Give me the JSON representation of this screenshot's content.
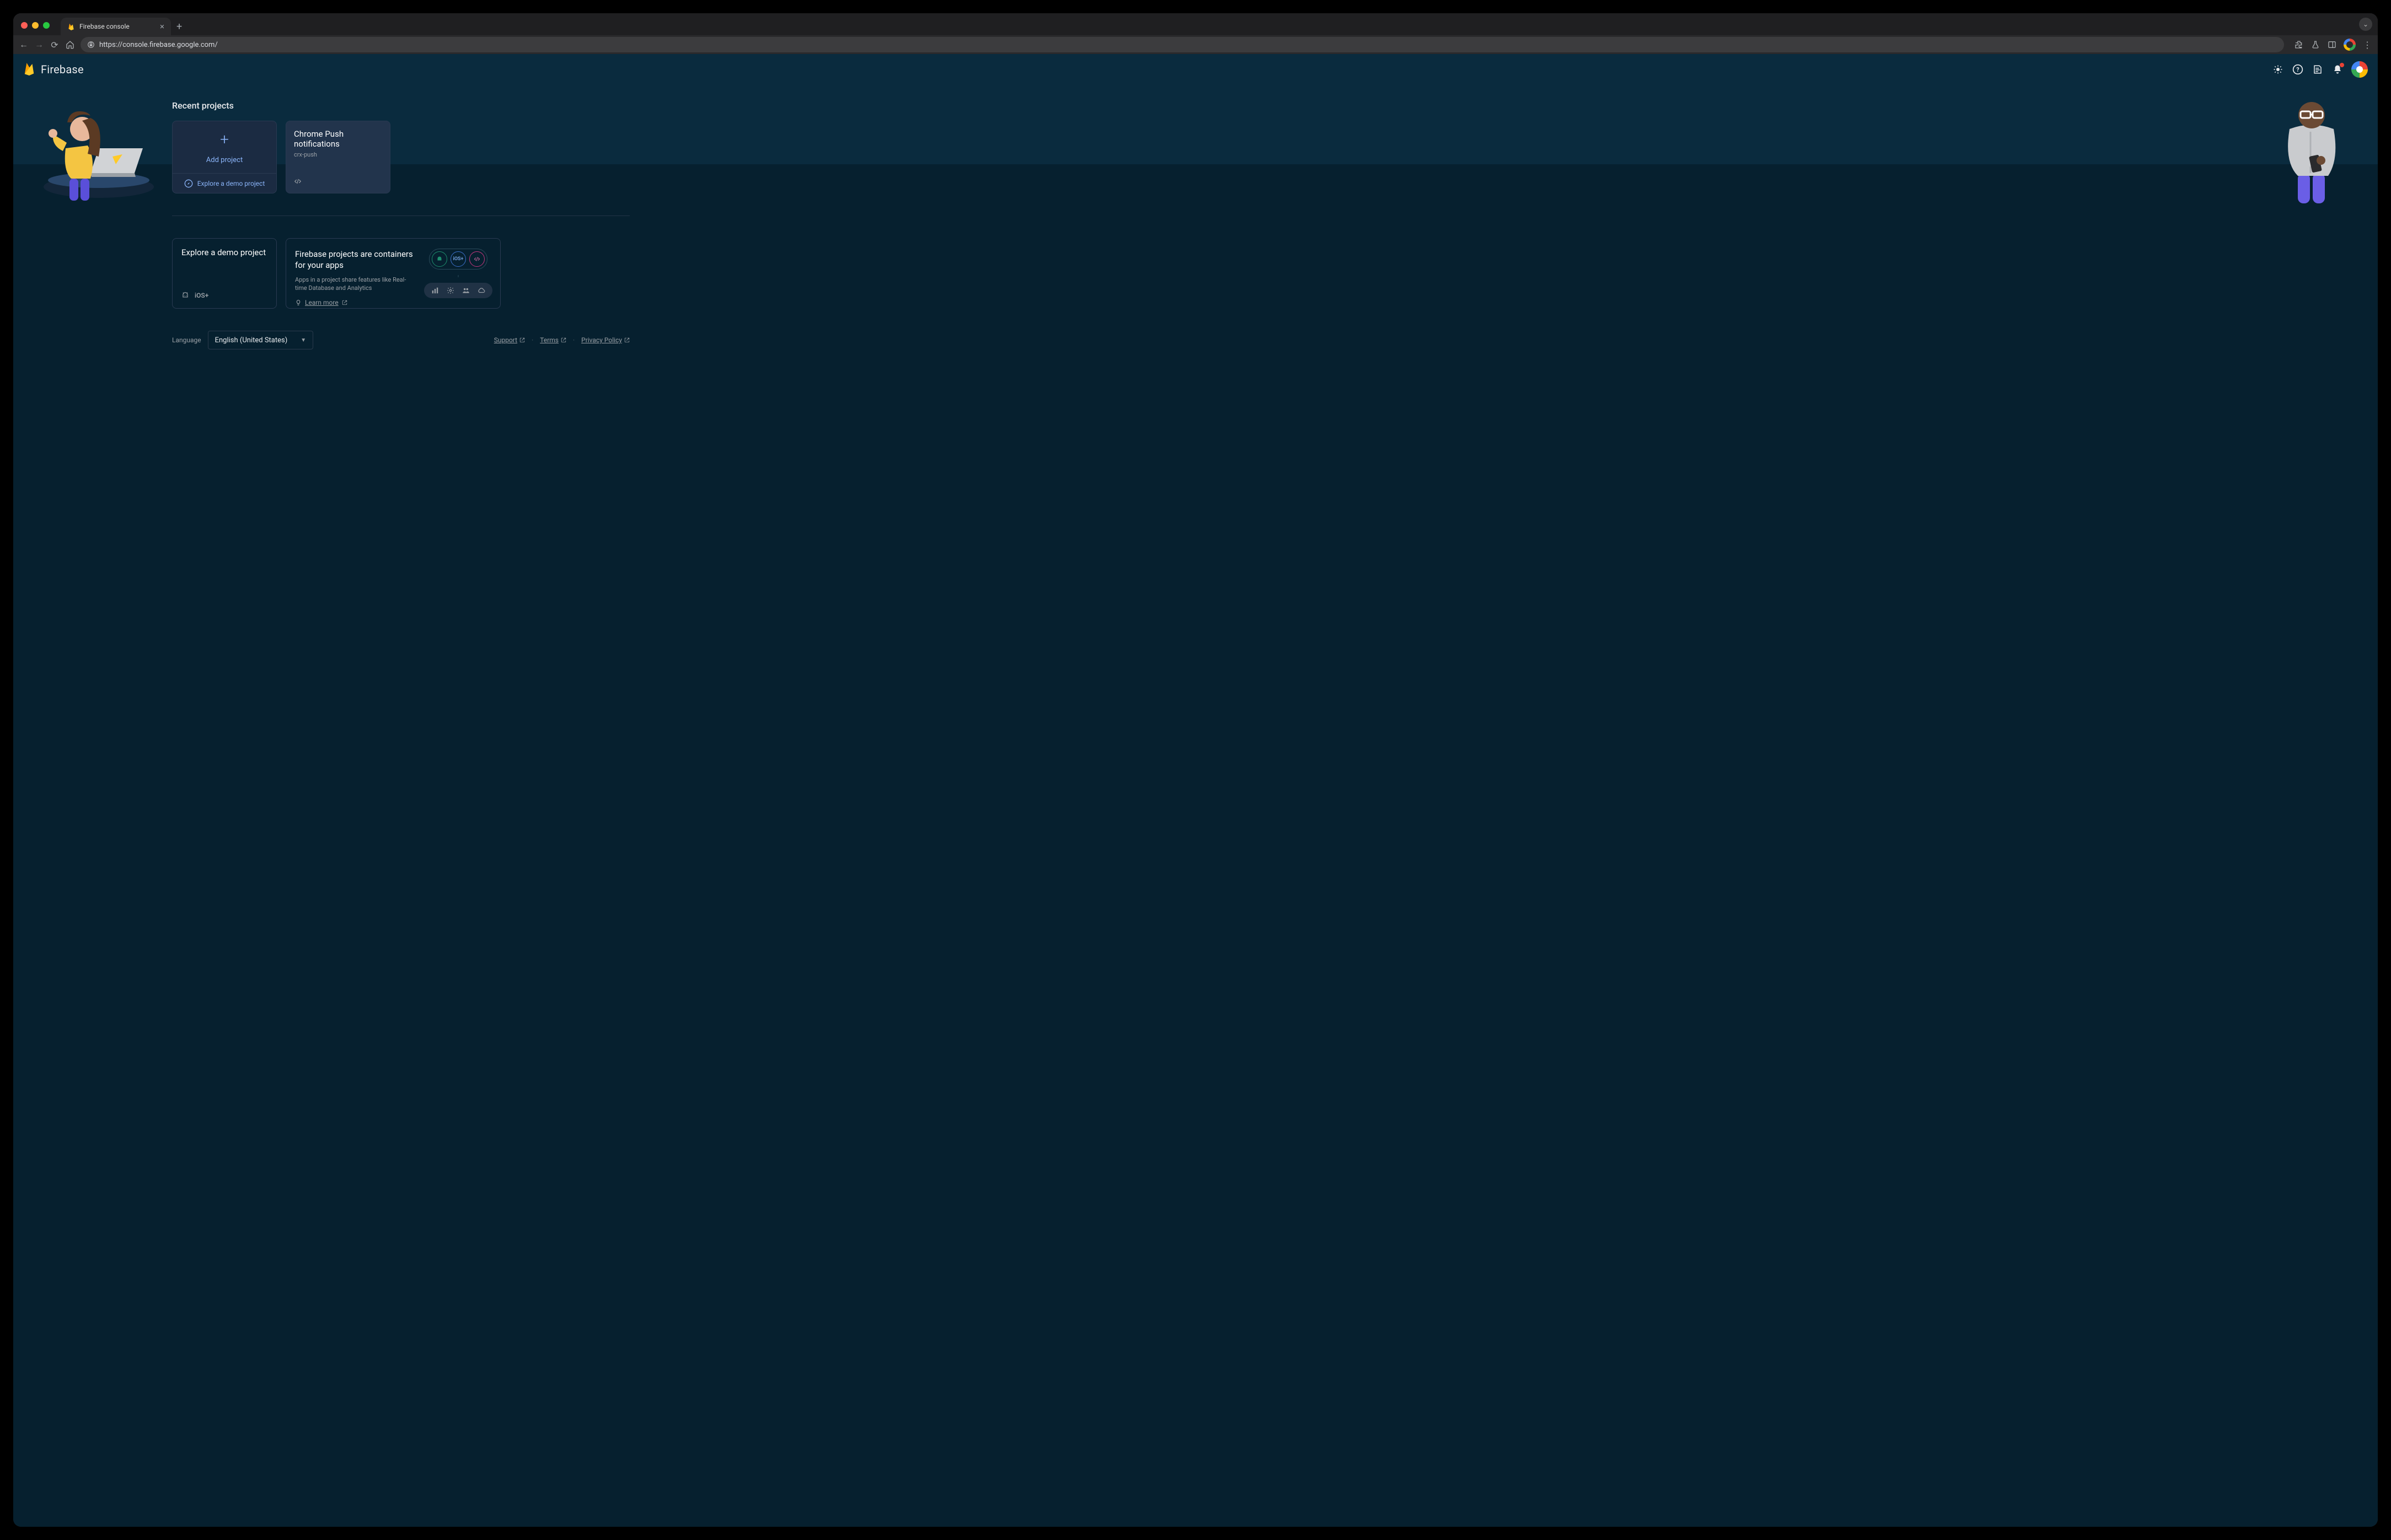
{
  "browser": {
    "tab_title": "Firebase console",
    "url": "https://console.firebase.google.com/"
  },
  "header": {
    "brand": "Firebase"
  },
  "recent": {
    "title": "Recent projects",
    "add_label": "Add project",
    "explore_label": "Explore a demo project",
    "projects": [
      {
        "name": "Chrome Push notifications",
        "id": "crx-push"
      }
    ]
  },
  "explore_card": {
    "title": "Explore a demo project",
    "ios_label": "iOS+"
  },
  "container_card": {
    "title": "Firebase projects are containers for your apps",
    "sub": "Apps in a project share features like Real-time Database and Analytics",
    "learn": "Learn more",
    "ios_label": "iOS+"
  },
  "footer": {
    "lang_label": "Language",
    "lang_value": "English (United States)",
    "support": "Support",
    "terms": "Terms",
    "privacy": "Privacy Policy"
  }
}
